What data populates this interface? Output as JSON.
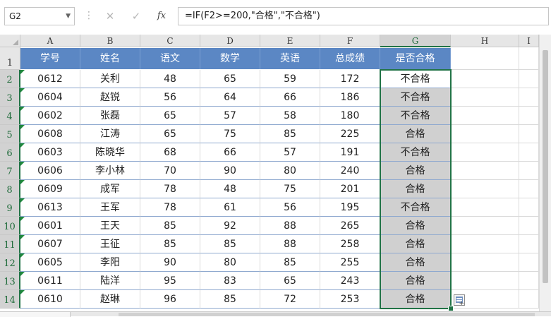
{
  "formula_bar": {
    "name_box": "G2",
    "cancel_icon": "close-icon",
    "enter_icon": "check-icon",
    "fx_label": "fx",
    "formula": "=IF(F2>=200,\"合格\",\"不合格\")"
  },
  "columns": [
    "A",
    "B",
    "C",
    "D",
    "E",
    "F",
    "G",
    "H",
    "I"
  ],
  "rows": [
    "1",
    "2",
    "3",
    "4",
    "5",
    "6",
    "7",
    "8",
    "9",
    "10",
    "11",
    "12",
    "13",
    "14"
  ],
  "table": {
    "headers": [
      "学号",
      "姓名",
      "语文",
      "数学",
      "英语",
      "总成绩",
      "是否合格"
    ],
    "rows": [
      [
        "0612",
        "关利",
        "48",
        "65",
        "59",
        "172",
        "不合格"
      ],
      [
        "0604",
        "赵锐",
        "56",
        "64",
        "66",
        "186",
        "不合格"
      ],
      [
        "0602",
        "张磊",
        "65",
        "57",
        "58",
        "180",
        "不合格"
      ],
      [
        "0608",
        "江涛",
        "65",
        "75",
        "85",
        "225",
        "合格"
      ],
      [
        "0603",
        "陈晓华",
        "68",
        "66",
        "57",
        "191",
        "不合格"
      ],
      [
        "0606",
        "李小林",
        "70",
        "90",
        "80",
        "240",
        "合格"
      ],
      [
        "0609",
        "成军",
        "78",
        "48",
        "75",
        "201",
        "合格"
      ],
      [
        "0613",
        "王军",
        "78",
        "61",
        "56",
        "195",
        "不合格"
      ],
      [
        "0601",
        "王天",
        "85",
        "92",
        "88",
        "265",
        "合格"
      ],
      [
        "0607",
        "王征",
        "85",
        "85",
        "88",
        "258",
        "合格"
      ],
      [
        "0605",
        "李阳",
        "90",
        "80",
        "85",
        "255",
        "合格"
      ],
      [
        "0611",
        "陆洋",
        "95",
        "83",
        "65",
        "243",
        "合格"
      ],
      [
        "0610",
        "赵琳",
        "96",
        "85",
        "72",
        "253",
        "合格"
      ]
    ]
  },
  "selection": {
    "column": "G",
    "first_row": 2,
    "last_row": 14,
    "active_cell": "G2"
  },
  "colors": {
    "header_fill": "#5b87c4",
    "header_text": "#ffffff",
    "selection_border": "#217346",
    "selected_fill": "#d0d0d0",
    "error_triangle": "#1f8a3c"
  }
}
